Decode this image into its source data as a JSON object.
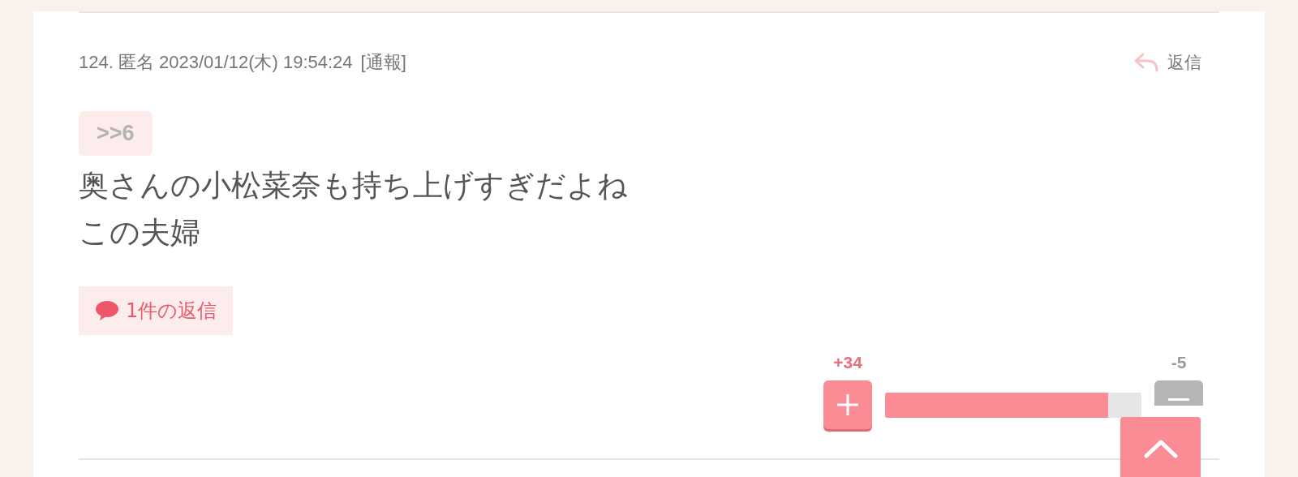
{
  "comment": {
    "header": "124. 匿名 2023/01/12(木) 19:54:24",
    "report_link": "[通報]",
    "reply_link": "返信",
    "anchor": ">>6",
    "body_lines": [
      "奥さんの小松菜奈も持ち上げすぎだよね",
      "この夫婦"
    ],
    "replies_badge": "1件の返信"
  },
  "vote": {
    "plus_count": "+34",
    "minus_count": "-5",
    "level": 0.87
  }
}
